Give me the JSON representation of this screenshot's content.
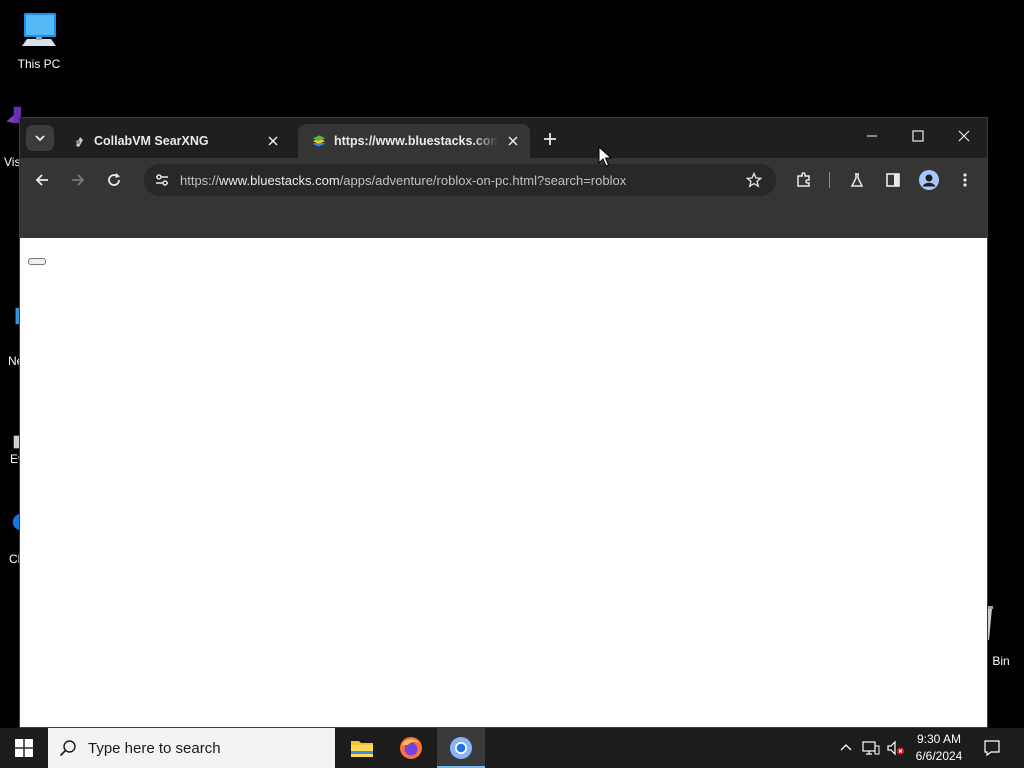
{
  "desktop": {
    "icons": [
      {
        "label": "This PC"
      },
      {
        "label": "Vis"
      },
      {
        "label": "Ne"
      },
      {
        "label": "Ev"
      },
      {
        "label": "Cl"
      },
      {
        "label": "Bin"
      }
    ]
  },
  "browser": {
    "tabs": [
      {
        "title": "CollabVM SearXNG",
        "active": false,
        "favicon": "searxng-icon"
      },
      {
        "title": "https://www.bluestacks.com/apps/adventure/roblox-on-pc.html?search=roblox",
        "active": true,
        "favicon": "bluestacks-icon"
      }
    ],
    "address_bar": {
      "scheme": "https://",
      "host": "www.bluestacks.com",
      "path": "/apps/adventure/roblox-on-pc.html?search=roblox"
    },
    "colors": {
      "frame": "#1f1f1f",
      "toolbar": "#353535",
      "omnibox": "#282828",
      "page": "#ffffff"
    }
  },
  "taskbar": {
    "search_placeholder": "Type here to search",
    "apps": [
      "file-explorer",
      "firefox",
      "chrome"
    ],
    "active_app": "chrome",
    "clock": {
      "time": "9:30 AM",
      "date": "6/6/2024"
    }
  }
}
